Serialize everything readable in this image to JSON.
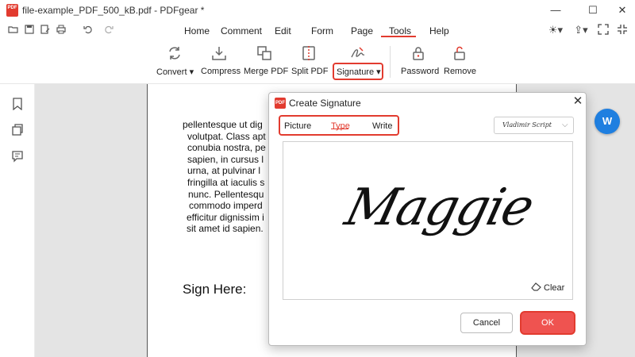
{
  "window": {
    "logo_text": "PDF",
    "title": "file-example_PDF_500_kB.pdf - PDFgear *",
    "minimize_glyph": "—",
    "maximize_glyph": "☐",
    "close_glyph": "✕"
  },
  "quick_access": [
    "open-folder-icon",
    "save-icon",
    "edit-icon",
    "print-icon",
    "undo-icon",
    "redo-icon"
  ],
  "menu": {
    "items": [
      "Home",
      "Comment",
      "Edit",
      "Form",
      "Page",
      "Tools",
      "Help"
    ],
    "active": "Tools"
  },
  "right_icons": [
    "theme-icon",
    "share-icon",
    "fullscreen-icon"
  ],
  "ribbon": {
    "tools": [
      {
        "label": "Convert ▾",
        "icon": "convert-icon"
      },
      {
        "label": "Compress",
        "icon": "compress-icon"
      },
      {
        "label": "Merge PDF",
        "icon": "merge-icon"
      },
      {
        "label": "Split PDF",
        "icon": "split-icon"
      },
      {
        "label": "Signature ▾",
        "icon": "signature-icon"
      },
      {
        "label": "Password",
        "icon": "lock-icon"
      },
      {
        "label": "Remove",
        "icon": "unlock-icon"
      }
    ]
  },
  "left_rail": [
    "bookmark-icon",
    "pages-icon",
    "comments-icon"
  ],
  "document": {
    "lines": [
      "pellentesque ut dig",
      "volutpat. Class apt",
      "conubia nostra, pe",
      "sapien, in cursus l",
      "urna, at pulvinar l",
      "fringilla at iaculis s",
      "nunc. Pellentesqu",
      "commodo imperd",
      "efficitur dignissim i",
      "sit amet id sapien."
    ],
    "sign_label": "Sign Here:"
  },
  "floating_button": {
    "icon": "convert-to-word-icon",
    "label": "W"
  },
  "dialog": {
    "logo_text": "PDF",
    "title": "Create Signature",
    "tabs": [
      "Picture",
      "Type",
      "Write"
    ],
    "selected_tab": "Type",
    "font_selected": "Vladimir Script",
    "signature_text": "Maggie",
    "clear_label": "Clear",
    "cancel_label": "Cancel",
    "ok_label": "OK"
  },
  "colors": {
    "accent": "#e23b2f",
    "ok_button": "#ef5350",
    "float_button": "#1f7fe0"
  }
}
